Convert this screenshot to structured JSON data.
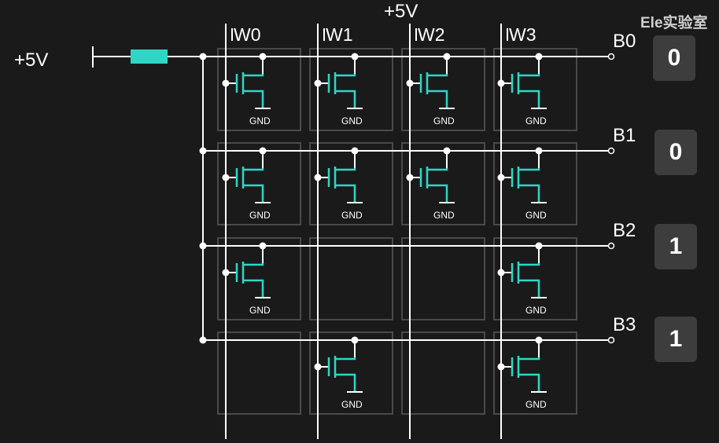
{
  "supply_label_top": "+5V",
  "supply_label_left": "+5V",
  "brand": "Ele实验室",
  "gnd_label": "GND",
  "columns": [
    "W0",
    "W1",
    "W2",
    "W3"
  ],
  "rows": [
    {
      "label": "B0",
      "output": "0",
      "transistors": [
        true,
        true,
        true,
        true
      ]
    },
    {
      "label": "B1",
      "output": "0",
      "transistors": [
        true,
        true,
        true,
        true
      ]
    },
    {
      "label": "B2",
      "output": "1",
      "transistors": [
        true,
        false,
        false,
        true
      ]
    },
    {
      "label": "B3",
      "output": "1",
      "transistors": [
        false,
        true,
        false,
        true
      ]
    }
  ],
  "colors": {
    "background": "#1a1a1a",
    "wire": "#ffffff",
    "cell_border": "#4a4a4a",
    "transistor": "#2fd6c6",
    "resistor": "#2fd6c6",
    "output_box": "#3d3d3d"
  }
}
